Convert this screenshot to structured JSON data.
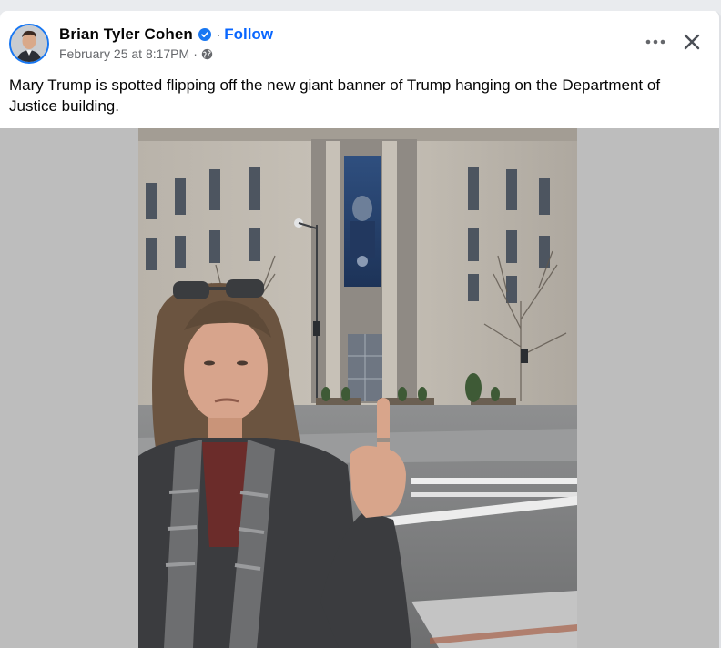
{
  "post": {
    "author": "Brian Tyler Cohen",
    "follow_label": "Follow",
    "timestamp": "February 25 at 8:17PM",
    "separator": "·",
    "caption": "Mary Trump is spotted flipping off the new giant banner of Trump hanging on the Department of Justice building."
  },
  "icons": {
    "verified": "verified-badge-icon",
    "privacy": "globe-icon",
    "more": "more-options-icon",
    "close": "close-icon"
  },
  "colors": {
    "accent": "#0866ff",
    "verified": "#1877f2",
    "text_primary": "#050505",
    "text_secondary": "#65676b",
    "media_background": "#bdbdbd"
  }
}
